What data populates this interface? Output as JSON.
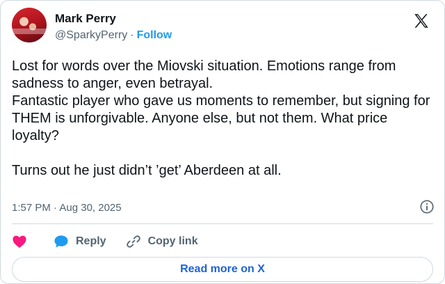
{
  "author": {
    "display_name": "Mark Perry",
    "handle": "@SparkyPerry",
    "separator": "·",
    "follow_label": "Follow"
  },
  "tweet": {
    "text": "Lost for words over the Miovski situation. Emotions range from sadness to anger, even betrayal.\nFantastic player who gave us moments to remember, but signing for THEM is unforgivable. Anyone else, but not them. What price loyalty?\n\nTurns out he just didn’t ’get’ Aberdeen at all.",
    "timestamp": "1:57 PM · Aug 30, 2025"
  },
  "actions": {
    "reply_label": "Reply",
    "copy_link_label": "Copy link"
  },
  "read_more_label": "Read more on X",
  "icons": {
    "like": "heart-icon",
    "reply": "speech-bubble-icon",
    "copy": "link-icon",
    "info": "info-icon",
    "logo": "x-logo-icon"
  },
  "colors": {
    "like": "#f91880",
    "reply": "#1d9bf0",
    "follow": "#1d9bf0",
    "read_more": "#1d63d6"
  }
}
